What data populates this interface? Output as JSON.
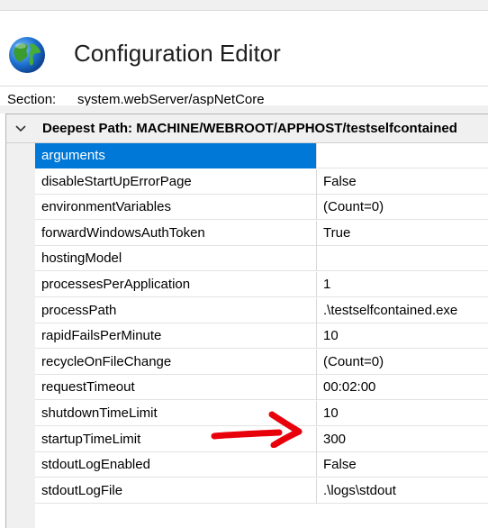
{
  "header": {
    "title": "Configuration Editor",
    "icon": "globe-icon"
  },
  "section": {
    "label": "Section:",
    "value": "system.webServer/aspNetCore"
  },
  "grid": {
    "group_label": "Deepest Path: MACHINE/WEBROOT/APPHOST/testselfcontained",
    "rows": [
      {
        "name": "arguments",
        "value": "",
        "selected": true
      },
      {
        "name": "disableStartUpErrorPage",
        "value": "False"
      },
      {
        "name": "environmentVariables",
        "value": "(Count=0)"
      },
      {
        "name": "forwardWindowsAuthToken",
        "value": "True"
      },
      {
        "name": "hostingModel",
        "value": ""
      },
      {
        "name": "processesPerApplication",
        "value": "1"
      },
      {
        "name": "processPath",
        "value": ".\\testselfcontained.exe"
      },
      {
        "name": "rapidFailsPerMinute",
        "value": "10"
      },
      {
        "name": "recycleOnFileChange",
        "value": "(Count=0)"
      },
      {
        "name": "requestTimeout",
        "value": "00:02:00"
      },
      {
        "name": "shutdownTimeLimit",
        "value": "10"
      },
      {
        "name": "startupTimeLimit",
        "value": "300"
      },
      {
        "name": "stdoutLogEnabled",
        "value": "False"
      },
      {
        "name": "stdoutLogFile",
        "value": ".\\logs\\stdout"
      }
    ]
  },
  "annotation": {
    "color": "#e8000b",
    "icon": "red-arrow-annotation"
  },
  "colors": {
    "selection": "#0078d7",
    "toolbar_bg": "#f0f0f0"
  }
}
